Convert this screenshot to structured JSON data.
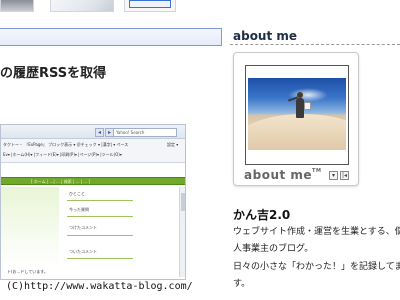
{
  "article": {
    "title": "の履歴RSSを取得"
  },
  "screenshot": {
    "search_placeholder": "Yahoo! Search",
    "nav_left": "◂",
    "nav_right": "▸",
    "toolbar_row1": "タクトー・ 『ExPage』 ブロック表示 ▾  ＠チェック ▾   |漢字| ▾   ペース",
    "toolbar_row2": "Ev▾    |ホーム(H)▾  |フィード(E)▾   |印刷(P)▾  |ページ(P)▾  |ツール(O)▾",
    "menu_right": "設定 ▾",
    "page_nav_links": "[ ホーム | ...| ... | 検索 | ... | ... ]",
    "side_labels": [
      "ひとこと",
      "今った質問",
      "つけたコメント",
      "ついたコメント"
    ],
    "footer_text": "ト(お...ドしています。"
  },
  "copyright": "(C)http://www.wakatta-blog.com/",
  "sidebar": {
    "heading": "about me",
    "brand_text": "abo",
    "brand_text_2": "ut me",
    "brand_tm": "TM",
    "card_buttons": [
      "▾",
      "|◂"
    ],
    "profile_name": "かん吉2.0",
    "bio_lines": [
      "ウェブサイト作成・運営を生業とする、個",
      "人事業主のブログ。",
      "日々の小さな「わかった！」を記録してま",
      "す。"
    ]
  },
  "colors": {
    "accent_blue": "#7e9ad8",
    "page_nav_green": "#6fa82a",
    "heading_text": "#1f2e44"
  }
}
